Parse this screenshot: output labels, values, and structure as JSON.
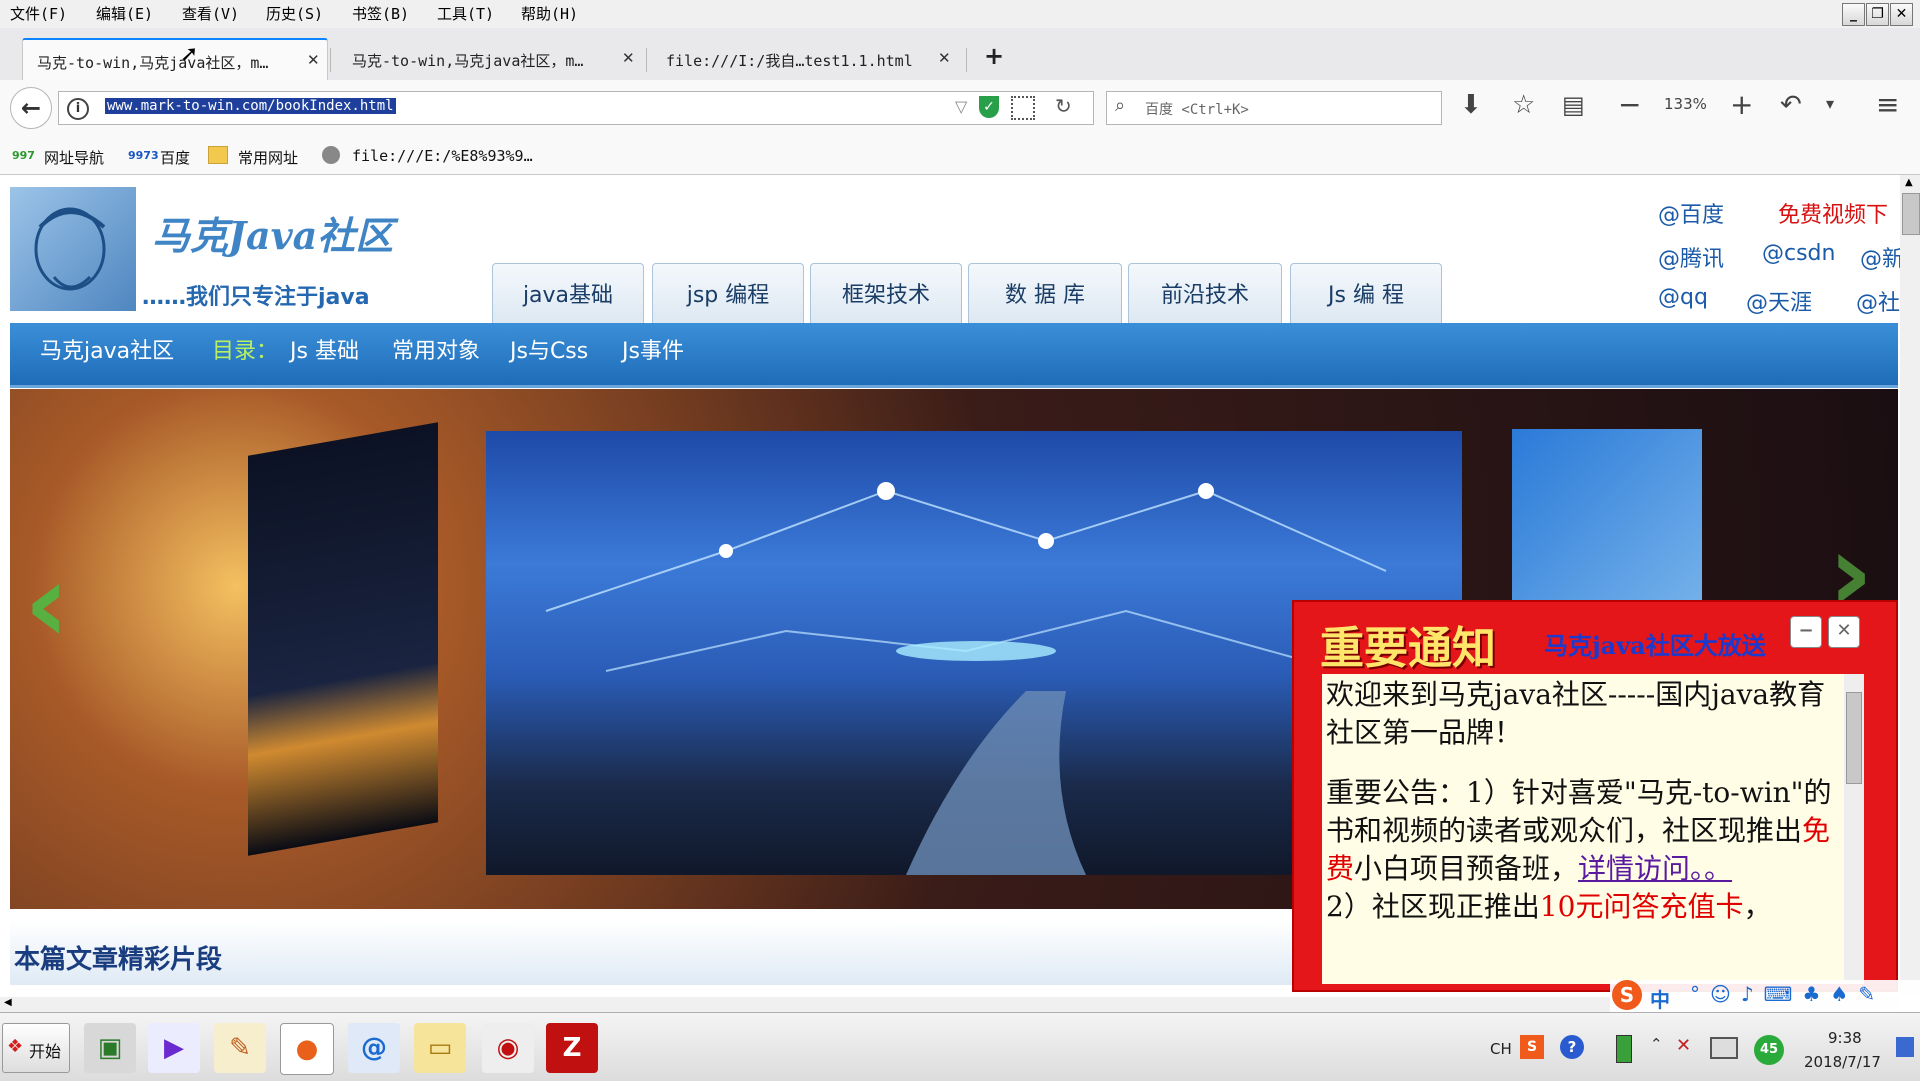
{
  "menu": [
    "文件(F)",
    "编辑(E)",
    "查看(V)",
    "历史(S)",
    "书签(B)",
    "工具(T)",
    "帮助(H)"
  ],
  "window_buttons": [
    "_",
    "❐",
    "✕"
  ],
  "tabs": [
    {
      "label": "马克-to-win,马克java社区，m…",
      "active": true
    },
    {
      "label": "马克-to-win,马克java社区，m…",
      "active": false
    },
    {
      "label": "file:///I:/我自…test1.1.html",
      "active": false
    }
  ],
  "new_tab_label": "+",
  "address": {
    "url": "www.mark-to-win.com/bookIndex.html"
  },
  "search": {
    "placeholder": "百度 <Ctrl+K>"
  },
  "zoom": "133%",
  "bookmarks": [
    {
      "badge": "997",
      "label": "网址导航"
    },
    {
      "badge": "9973",
      "label": "百度"
    },
    {
      "badge": "",
      "label": "常用网址"
    },
    {
      "badge": "",
      "label": "file:///E:/%E8%93%9…"
    }
  ],
  "site": {
    "logo_title": "马克Java社区",
    "logo_slogan": "……我们只专注于java",
    "nav_tabs": [
      "java基础",
      "jsp 编程",
      "框架技术",
      "数 据 库",
      "前沿技术",
      "Js 编 程"
    ],
    "external_links_row1": [
      "@百度",
      "免费视频下"
    ],
    "external_links_row2": [
      "@腾讯",
      "@csdn",
      "@新"
    ],
    "external_links_row3": [
      "@qq",
      "@天涯",
      "@社"
    ],
    "breadcrumb_home": "马克java社区",
    "toc_label": "目录：",
    "toc_items": [
      "Js 基础",
      "常用对象",
      "Js与Css",
      "Js事件"
    ],
    "section_heading": "本篇文章精彩片段"
  },
  "popup": {
    "title": "重要通知",
    "subtitle": "马克java社区大放送",
    "line1": "欢迎来到马克java社区-----国内java教育社区第一品牌！",
    "notice_prefix": "重要公告：1）针对喜爱\"马克-to-win\"的书和视频的读者或观众们，社区现推出",
    "notice_free": "免费",
    "notice_mid": "小白项目预备班，",
    "notice_link": "详情访问。。",
    "notice2_prefix": "2）社区现正推出",
    "notice2_highlight": "10元问答充值卡",
    "notice2_suffix": "，"
  },
  "taskbar": {
    "start_label": "开始",
    "tray_lang": "CH",
    "tray_badge": "45",
    "time": "9:38",
    "date": "2018/7/17"
  },
  "ime_label": "中",
  "colors": {
    "site_blue": "#2677c4",
    "popup_red": "#e4161a",
    "accent": "#0a84ff"
  }
}
